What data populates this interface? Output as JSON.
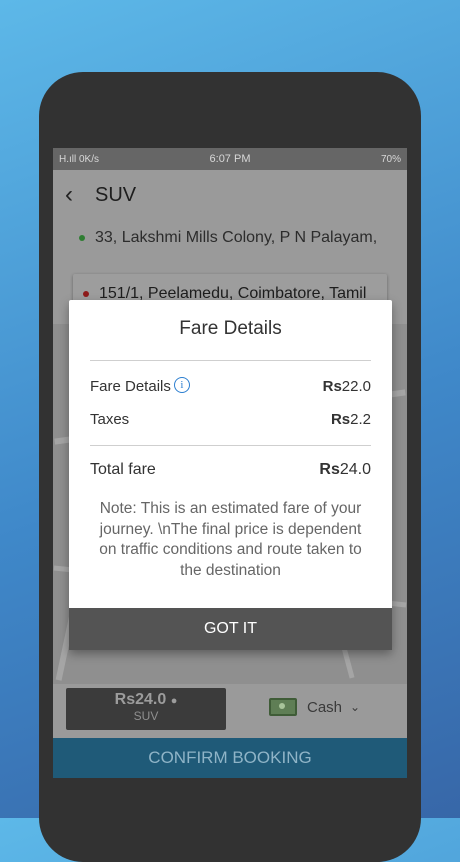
{
  "status_bar": {
    "left": "H.ıll 0K/s",
    "time": "6:07 PM",
    "right": "70%"
  },
  "header": {
    "back_icon": "back-arrow-icon",
    "title": "SUV"
  },
  "pickup": {
    "address": "33, Lakshmi Mills Colony, P N Palayam,"
  },
  "drop": {
    "address": "151/1, Peelamedu, Coimbatore, Tamil"
  },
  "fare_summary": {
    "amount": "Rs24.0",
    "vehicle": "SUV"
  },
  "payment": {
    "method": "Cash"
  },
  "confirm_button": "CONFIRM BOOKING",
  "dialog": {
    "title": "Fare Details",
    "rows": [
      {
        "label": "Fare Details",
        "currency": "Rs",
        "amount": "22.0"
      },
      {
        "label": "Taxes",
        "currency": "Rs",
        "amount": "2.2"
      }
    ],
    "total": {
      "label": "Total fare",
      "currency": "Rs",
      "amount": "24.0"
    },
    "note": "Note: This is an estimated fare of your journey. \\nThe final price is dependent on traffic conditions and route taken to the destination",
    "button": "GOT IT"
  },
  "colors": {
    "confirm_bar": "#1f5a78",
    "dialog_button": "#545454",
    "info_icon": "#2d7fd0"
  }
}
